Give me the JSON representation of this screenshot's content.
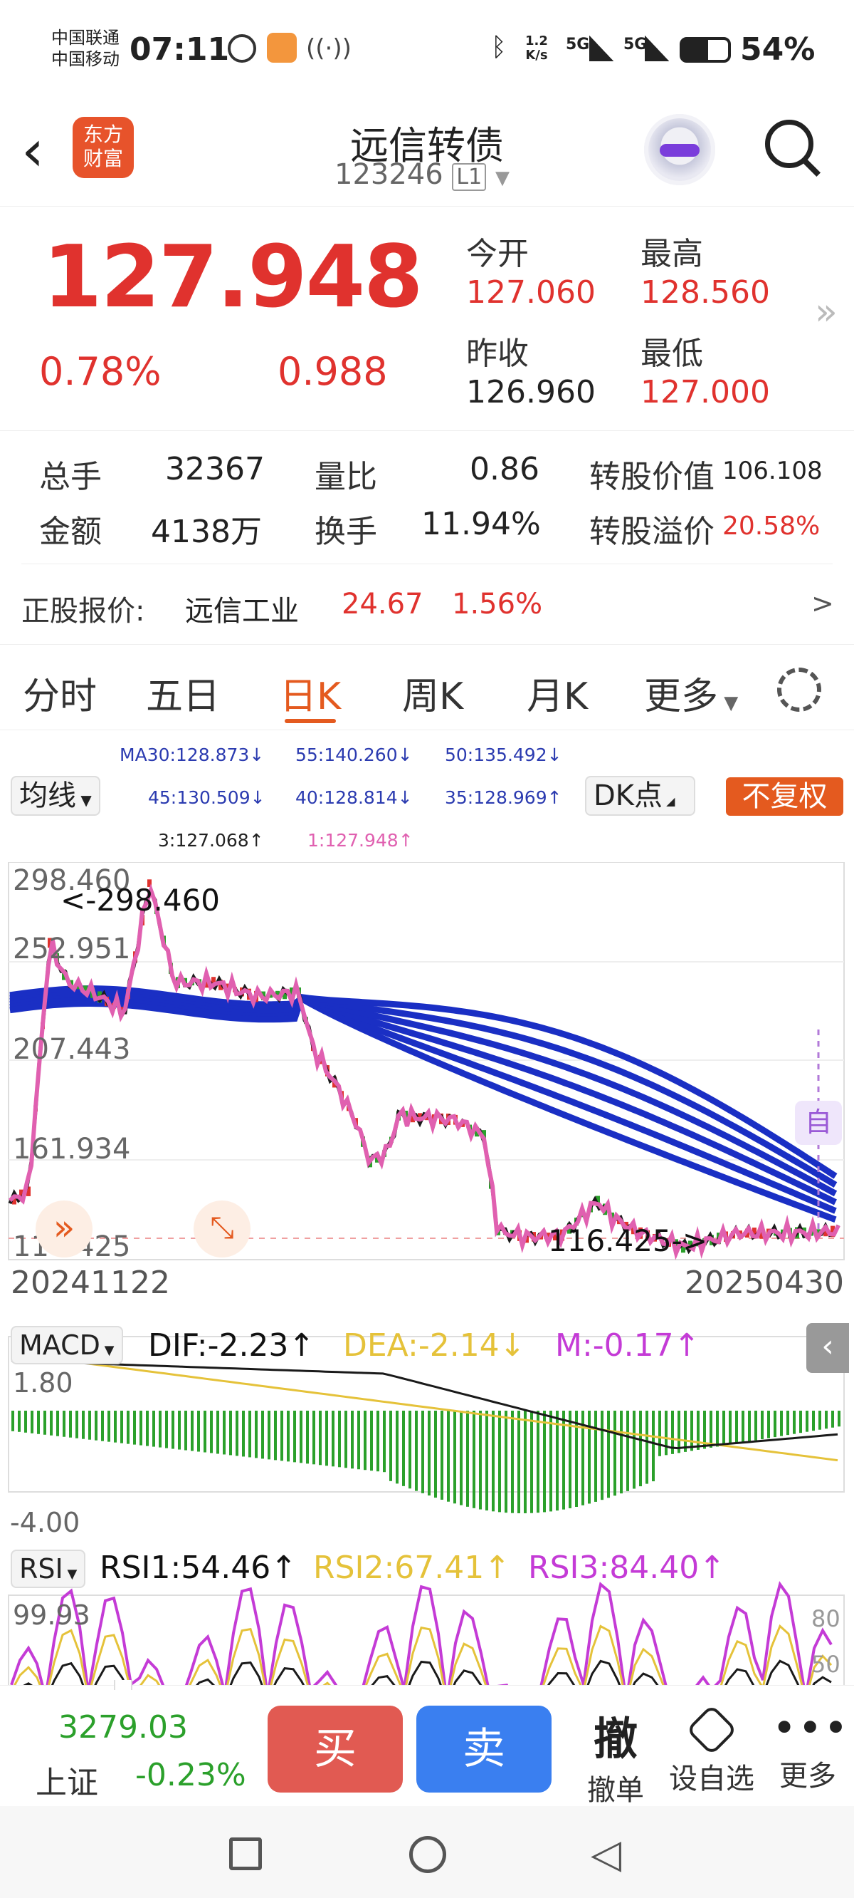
{
  "status": {
    "carrier1": "中国联通",
    "carrier2": "中国移动",
    "time": "07:11",
    "speed_val": "1.2",
    "speed_unit": "K/s",
    "net1": "5G",
    "net2": "5G",
    "battery": "54%"
  },
  "header": {
    "name": "远信转债",
    "code": "123246",
    "level": "L1",
    "logo_line1": "东方",
    "logo_line2": "财富"
  },
  "quote": {
    "price": "127.948",
    "pct": "0.78%",
    "change": "0.988",
    "open_label": "今开",
    "open": "127.060",
    "high_label": "最高",
    "high": "128.560",
    "prev_label": "昨收",
    "prev": "126.960",
    "low_label": "最低",
    "low": "127.000"
  },
  "stats": {
    "vol_label": "总手",
    "vol": "32367",
    "ratio_label": "量比",
    "ratio": "0.86",
    "conv_val_label": "转股价值",
    "conv_val": "106.108",
    "amt_label": "金额",
    "amt": "4138万",
    "turn_label": "换手",
    "turn": "11.94%",
    "premium_label": "转股溢价",
    "premium": "20.58%",
    "stock_label": "正股报价:",
    "stock_name": "远信工业",
    "stock_price": "24.67",
    "stock_pct": "1.56%",
    "more": ">"
  },
  "tabs": [
    "分时",
    "五日",
    "日K",
    "周K",
    "月K",
    "更多"
  ],
  "active_tab": "日K",
  "ma": {
    "ma30": "MA30:128.873↓",
    "ma55": "55:140.260↓",
    "ma50": "50:135.492↓",
    "ma45": "45:130.509↓",
    "ma40": "40:128.814↓",
    "ma35": "35:128.969↑",
    "ma3": "3:127.068↑",
    "ma1": "1:127.948↑"
  },
  "controls": {
    "avg": "均线",
    "dk": "DK点",
    "fq": "不复权",
    "self": "自"
  },
  "kline": {
    "y1": "298.460",
    "y2": "252.951",
    "y3": "207.443",
    "y4": "161.934",
    "y5": "116.425",
    "max_label": "<-298.460",
    "min_label": "116.425->",
    "date_start": "20241122",
    "date_end": "20250430"
  },
  "macd": {
    "label": "MACD",
    "dif": "DIF:-2.23↑",
    "dea": "DEA:-2.14↓",
    "m": "M:-0.17↑",
    "y_top": "1.80",
    "y_bottom": "-4.00"
  },
  "rsi": {
    "label": "RSI",
    "rsi1": "RSI1:54.46↑",
    "rsi2": "RSI2:67.41↑",
    "rsi3": "RSI3:84.40↑",
    "y_top": "99.93",
    "r80": "80",
    "r50": "50"
  },
  "index": {
    "value": "3279.03",
    "name": "上证",
    "pct": "-0.23%"
  },
  "actions": {
    "buy": "买",
    "sell": "卖",
    "cancel_icon": "撤",
    "cancel": "撤单",
    "watch": "设自选",
    "more": "更多"
  },
  "colors": {
    "up": "#e0322e",
    "down": "#2ba02b",
    "accent": "#e45a1f",
    "ma_blue": "#1a2fc4",
    "line_pink": "#e060b0",
    "dea_yellow": "#e5c23a",
    "rsi_purple": "#c43bd6"
  },
  "chart_data": {
    "type": "line",
    "ylim": [
      116.425,
      298.46
    ],
    "x": [
      "20241122",
      "20250430"
    ]
  }
}
